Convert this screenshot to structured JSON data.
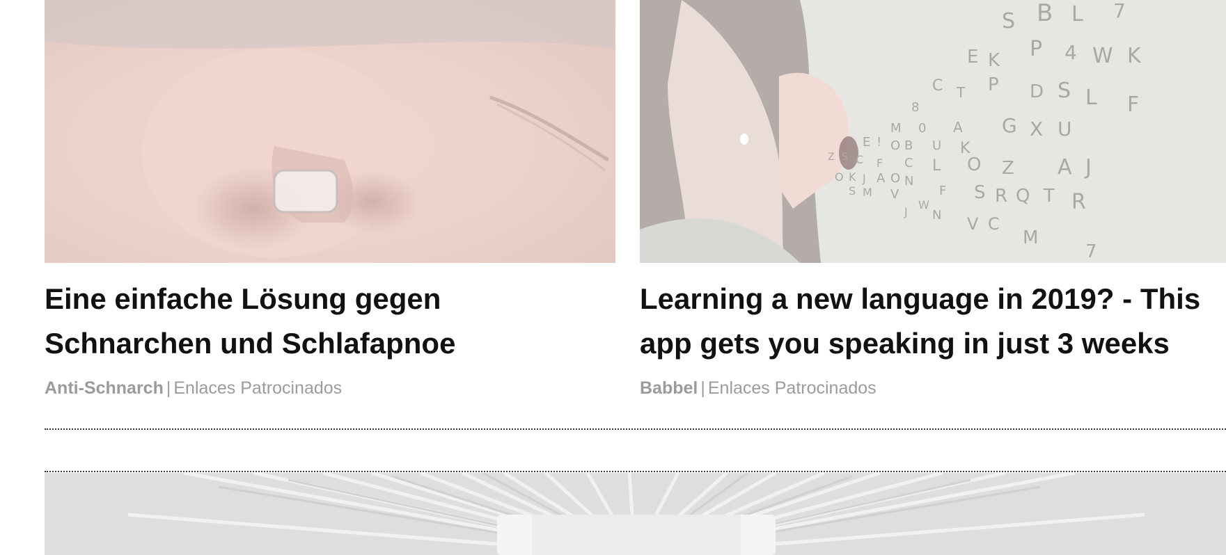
{
  "cards": [
    {
      "headline": "Eine einfache Lösung gegen Schnarchen und Schlafapnoe",
      "brand": "Anti-Schnarch",
      "separator": "|",
      "sponsor": "Enlaces Patrocinados",
      "image": "nose-clip-sleeping-face"
    },
    {
      "headline": "Learning a new language in 2019? - This app gets you speaking in just 3 weeks",
      "brand": "Babbel",
      "separator": "|",
      "sponsor": "Enlaces Patrocinados",
      "image": "woman-speaking-letters"
    }
  ],
  "bottom_ad": {
    "image": "light-burst-box"
  },
  "colors": {
    "headline": "#111111",
    "meta": "#9b9b9b",
    "divider": "#333333"
  }
}
